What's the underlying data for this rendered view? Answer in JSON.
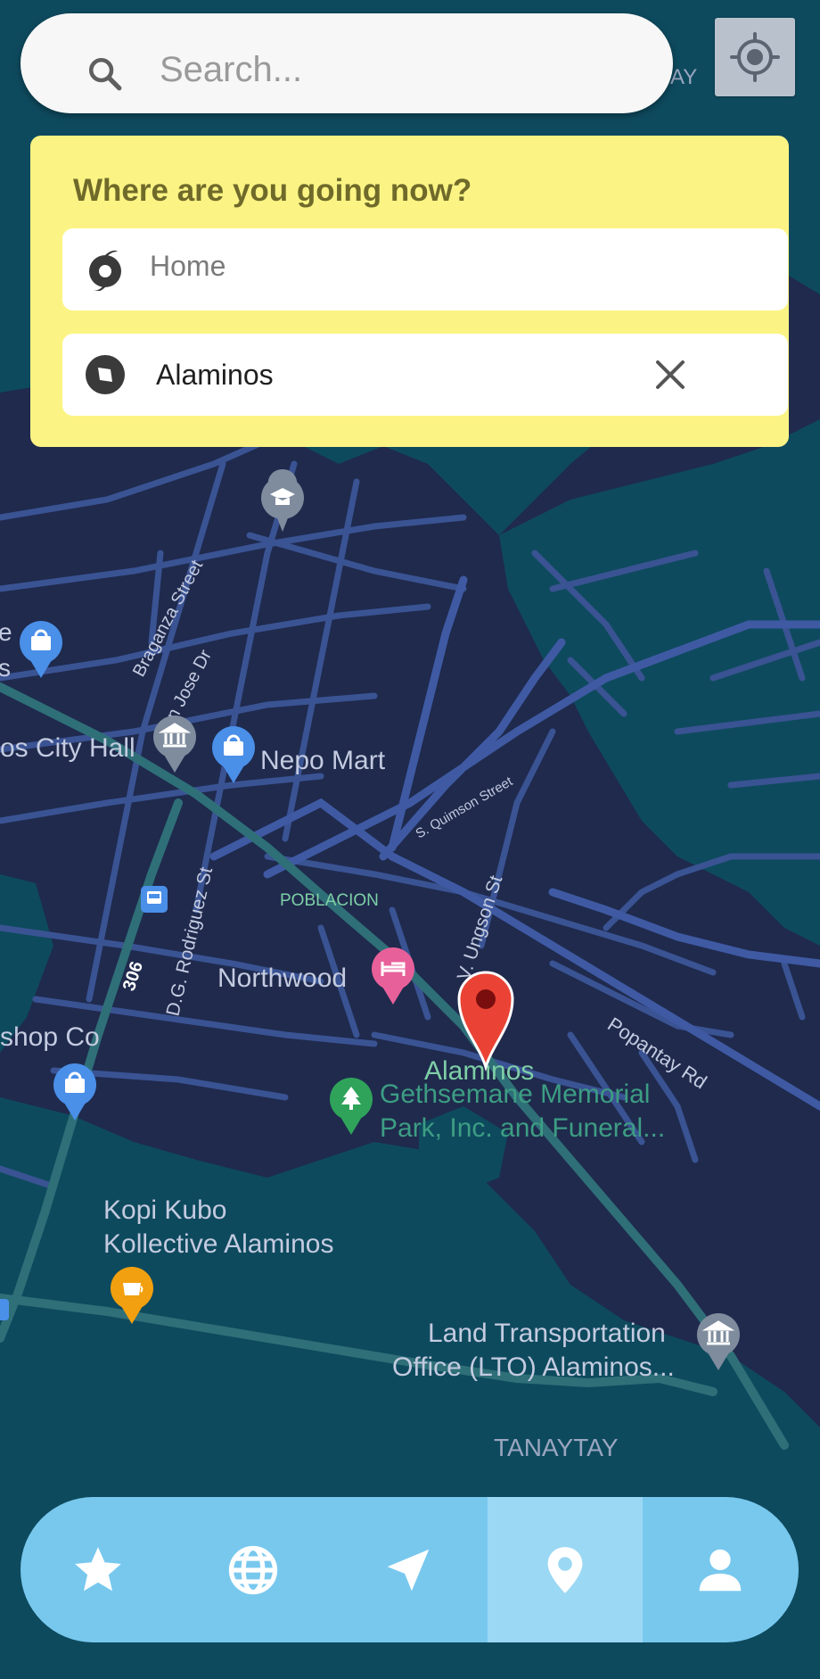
{
  "search": {
    "placeholder": "Search..."
  },
  "destination_panel": {
    "heading": "Where are you going now?",
    "origin": {
      "value": "Home"
    },
    "destination": {
      "value": "Alaminos"
    }
  },
  "map": {
    "labels": {
      "corner_top": "AY",
      "braganza": "Braganza Street",
      "san_jose": "San Jose Dr",
      "city_hall": "os City Hall",
      "nepo_mart": "Nepo Mart",
      "quimson": "S. Quimson Street",
      "poblacion": "POBLACION",
      "ungson": "V. Ungson St",
      "rodriguez": "D.G. Rodriguez St",
      "route": "306",
      "northwood": "Northwood",
      "popantay": "Popantay Rd",
      "shop_co": "shop Co",
      "alaminos": "Alaminos",
      "gethsemane_line1": "Gethsemane Memorial",
      "gethsemane_line2": "Park, Inc. and Funeral...",
      "kopi_line1": "Kopi Kubo",
      "kopi_line2": "Kollective Alaminos",
      "lto_line1": "Land Transportation",
      "lto_line2": "Office (LTO) Alaminos...",
      "tanaytay": "TANAYTAY",
      "left_edge_1": "e",
      "left_edge_2": "s"
    }
  },
  "nav": {
    "items": [
      {
        "icon": "star-icon",
        "active": false
      },
      {
        "icon": "globe-icon",
        "active": false
      },
      {
        "icon": "navigation-arrow-icon",
        "active": false
      },
      {
        "icon": "map-pin-icon",
        "active": true
      },
      {
        "icon": "person-icon",
        "active": false
      }
    ]
  },
  "colors": {
    "map_land": "#1f2a4d",
    "map_water": "#0e4a5e",
    "road": "#3a5393",
    "highway": "#2f6f78",
    "panel_bg": "#fbf484",
    "nav_bg": "#78c8ee",
    "nav_active": "#9bd8f4",
    "destination_marker": "#ea4335"
  }
}
